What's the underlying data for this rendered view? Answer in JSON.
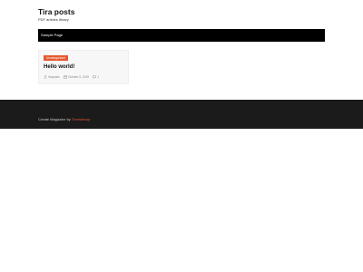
{
  "header": {
    "title": "Tira posts",
    "tagline": "PDF articles library"
  },
  "nav": {
    "items": [
      {
        "label": "Sample Page"
      }
    ]
  },
  "post": {
    "category": "Uncategorized",
    "title": "Hello world!",
    "author": "tiraposts",
    "date": "October 5, 2019",
    "comments": "1"
  },
  "footer": {
    "text": "Create Magazine by",
    "link": "Themeinwp"
  },
  "colors": {
    "accent": "#e4572e",
    "nav_background": "#000000",
    "footer_background": "#1b1b1b",
    "card_background": "#f7f7f7"
  },
  "icons": {
    "author": "user-icon",
    "date": "calendar-icon",
    "comments": "comment-icon"
  }
}
